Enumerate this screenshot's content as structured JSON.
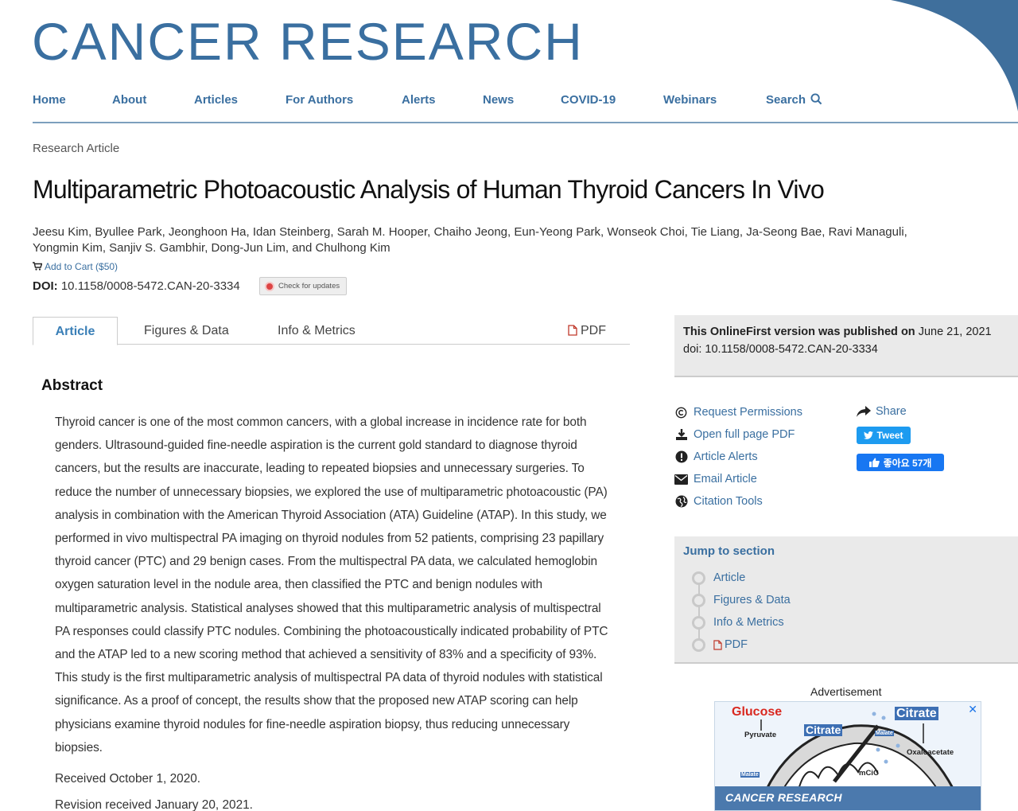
{
  "journal": {
    "name": "CANCER RESEARCH"
  },
  "nav": {
    "items": [
      "Home",
      "About",
      "Articles",
      "For Authors",
      "Alerts",
      "News",
      "COVID-19",
      "Webinars",
      "Search"
    ]
  },
  "article": {
    "type": "Research Article",
    "title": "Multiparametric Photoacoustic Analysis of Human Thyroid Cancers In Vivo",
    "authors": "Jeesu Kim, Byullee Park, Jeonghoon Ha, Idan Steinberg, Sarah M. Hooper, Chaiho Jeong, Eun-Yeong Park, Wonseok Choi, Tie Liang, Ja-Seong Bae, Ravi Managuli, Yongmin Kim, Sanjiv S. Gambhir, Dong-Jun Lim, and Chulhong Kim",
    "add_to_cart": "Add to Cart ($50)",
    "doi_label": "DOI:",
    "doi_value": "10.1158/0008-5472.CAN-20-3334",
    "check_updates": "Check for updates"
  },
  "tabs": [
    "Article",
    "Figures & Data",
    "Info & Metrics",
    "PDF"
  ],
  "abstract": {
    "heading": "Abstract",
    "text": "Thyroid cancer is one of the most common cancers, with a global increase in incidence rate for both genders. Ultrasound-guided fine-needle aspiration is the current gold standard to diagnose thyroid cancers, but the results are inaccurate, leading to repeated biopsies and unnecessary surgeries. To reduce the number of unnecessary biopsies, we explored the use of multiparametric photoacoustic (PA) analysis in combination with the American Thyroid Association (ATA) Guideline (ATAP). In this study, we performed in vivo multispectral PA imaging on thyroid nodules from 52 patients, comprising 23 papillary thyroid cancer (PTC) and 29 benign cases. From the multispectral PA data, we calculated hemoglobin oxygen saturation level in the nodule area, then classified the PTC and benign nodules with multiparametric analysis. Statistical analyses showed that this multiparametric analysis of multispectral PA responses could classify PTC nodules. Combining the photoacoustically indicated probability of PTC and the ATAP led to a new scoring method that achieved a sensitivity of 83% and a specificity of 93%. This study is the first multiparametric analysis of multispectral PA data of thyroid nodules with statistical significance. As a proof of concept, the results show that the proposed new ATAP scoring can help physicians examine thyroid nodules for fine-needle aspiration biopsy, thus reducing unnecessary biopsies.",
    "received": "Received October 1, 2020.",
    "revision": "Revision received January 20, 2021."
  },
  "sidebar": {
    "pub_prefix": "This OnlineFirst version was published on",
    "pub_date": "June 21, 2021",
    "pub_doi": "doi: 10.1158/0008-5472.CAN-20-3334",
    "tools": [
      "Request Permissions",
      "Open full page PDF",
      "Article Alerts",
      "Email Article",
      "Citation Tools"
    ],
    "share": "Share",
    "tweet": "Tweet",
    "like": "좋아요 57개",
    "jump_title": "Jump to section",
    "jump_items": [
      "Article",
      "Figures & Data",
      "Info & Metrics",
      "PDF"
    ]
  },
  "ad": {
    "label": "Advertisement",
    "close": "✕",
    "glucose": "Glucose",
    "citrate": "Citrate",
    "citrate_center": "Citrate",
    "pyruvate": "Pyruvate",
    "malate": "Malate",
    "oxaloacetate": "Oxaloacetate",
    "mcic": "mCiC",
    "banner": "CANCER RESEARCH"
  },
  "colors": {
    "brand_blue": "#3a6fa0",
    "tweet_blue": "#1d9bf0",
    "facebook_blue": "#1877f2",
    "panel_gray": "#eaeaea"
  }
}
